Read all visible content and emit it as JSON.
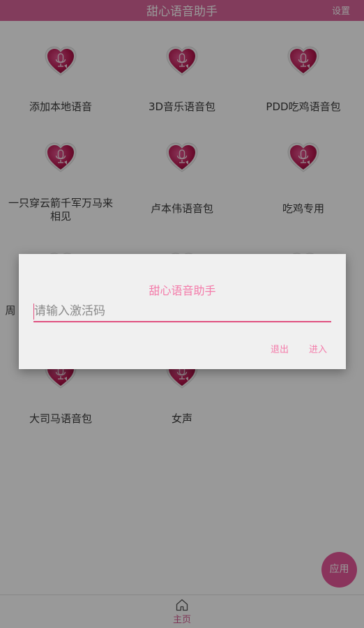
{
  "header": {
    "title": "甜心语音助手",
    "settings_label": "设置"
  },
  "grid": {
    "items": [
      {
        "label": "添加本地语音"
      },
      {
        "label": "3D音乐语音包"
      },
      {
        "label": "PDD吃鸡语音包"
      },
      {
        "label": "一只穿云箭千军万马来相见"
      },
      {
        "label": "卢本伟语音包"
      },
      {
        "label": "吃鸡专用"
      },
      {
        "label": "周"
      },
      {
        "label": ""
      },
      {
        "label": ""
      },
      {
        "label": "大司马语音包"
      },
      {
        "label": "女声"
      }
    ]
  },
  "icons": {
    "grid_item": "heart-microphone-icon",
    "home": "home-icon"
  },
  "fab": {
    "label": "应用"
  },
  "bottom_nav": {
    "home_label": "主页"
  },
  "dialog": {
    "title": "甜心语音助手",
    "input_placeholder": "请输入激活码",
    "input_value": "",
    "exit_label": "退出",
    "enter_label": "进入"
  },
  "colors": {
    "accent": "#d9649a",
    "dialog_accent": "#f47aa9",
    "underline": "#e0507f",
    "fab": "#e7589a"
  }
}
